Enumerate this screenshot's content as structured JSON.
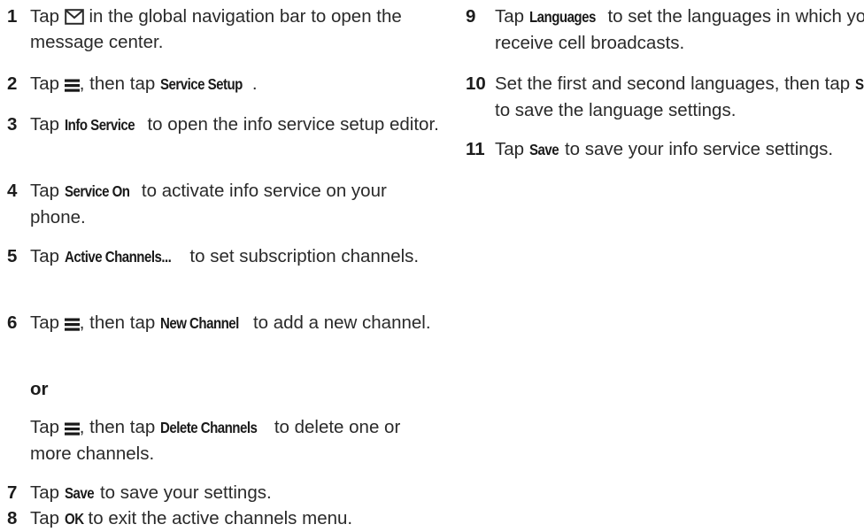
{
  "left_steps": {
    "s1": {
      "num": "1",
      "pre": "Tap",
      "post": "in the global navigation bar to open the message center.",
      "icon": "envelope-icon"
    },
    "s2": {
      "num": "2",
      "pre": "Tap",
      "mid": ", then tap",
      "bold": "Service Setup",
      "post": ".",
      "icon": "menu-icon"
    },
    "s3": {
      "num": "3",
      "pre": "Tap",
      "bold": "Info Service",
      "post": "to open the info service setup editor."
    },
    "s4": {
      "num": "4",
      "pre": "Tap",
      "bold": "Service On",
      "post": "to activate info service on your phone."
    },
    "s5": {
      "num": "5",
      "pre": "Tap",
      "bold": "Active Channels...",
      "post": "to set subscription channels."
    },
    "s6": {
      "num": "6",
      "pre": "Tap",
      "mid": ", then tap",
      "bold": "New Channel",
      "post": "to add a new channel.",
      "icon": "menu-icon"
    },
    "or": "or",
    "s6b": {
      "pre": "Tap",
      "mid": ", then tap",
      "bold": "Delete Channels",
      "post": "to delete one or more channels.",
      "icon": "menu-icon"
    },
    "s7": {
      "num": "7",
      "pre": "Tap",
      "bold": "Save",
      "post": "to save your settings."
    },
    "s8": {
      "num": "8",
      "pre": "Tap",
      "bold": "OK",
      "post": "to exit the active channels menu."
    }
  },
  "right_steps": {
    "s9": {
      "num": "9",
      "pre": "Tap",
      "bold": "Languages",
      "post": "to set the languages in which you receive cell broadcasts."
    },
    "s10": {
      "num": "10",
      "pre": "Set the first and second languages, then tap",
      "bold": "Save",
      "post": "to save the language settings."
    },
    "s11": {
      "num": "11",
      "pre": "Tap",
      "bold": "Save",
      "post": "to save your info service settings."
    }
  }
}
